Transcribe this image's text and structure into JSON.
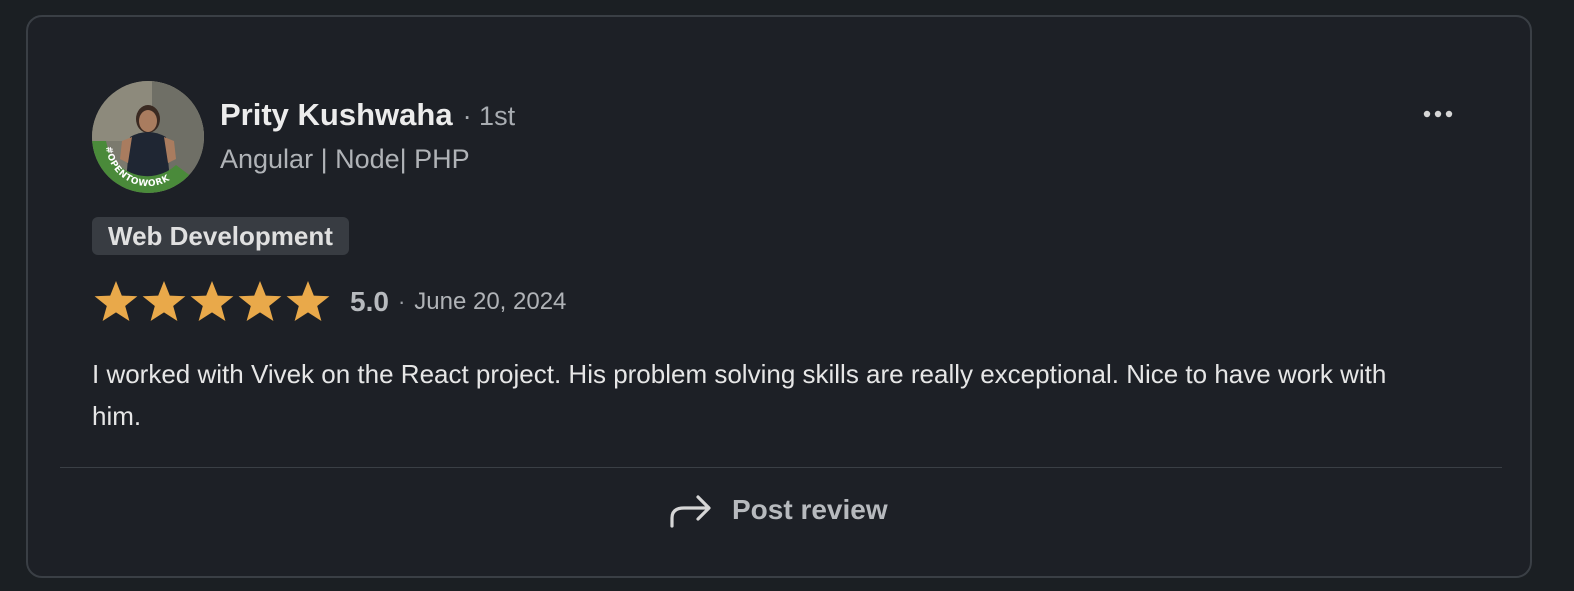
{
  "reviewer": {
    "name": "Prity Kushwaha",
    "degree": "· 1st",
    "headline": "Angular | Node| PHP",
    "avatar_badge": "#OPENTOWORK"
  },
  "menu": {
    "icon": "ellipsis-icon"
  },
  "tag": {
    "label": "Web Development"
  },
  "rating": {
    "stars": 5,
    "max_stars": 5,
    "score": "5.0",
    "separator": "·",
    "date": "June 20, 2024",
    "star_color": "#e9a94a"
  },
  "review": {
    "text": "I worked with Vivek on the React project. His problem solving skills are really exceptional. Nice to have work with him."
  },
  "actions": {
    "post_review_label": "Post review",
    "post_review_icon": "share-arrow-icon"
  },
  "colors": {
    "background": "#1b1f23",
    "card": "#1d2026",
    "border": "#3a3f45",
    "badge_green": "#4a8a3a"
  }
}
